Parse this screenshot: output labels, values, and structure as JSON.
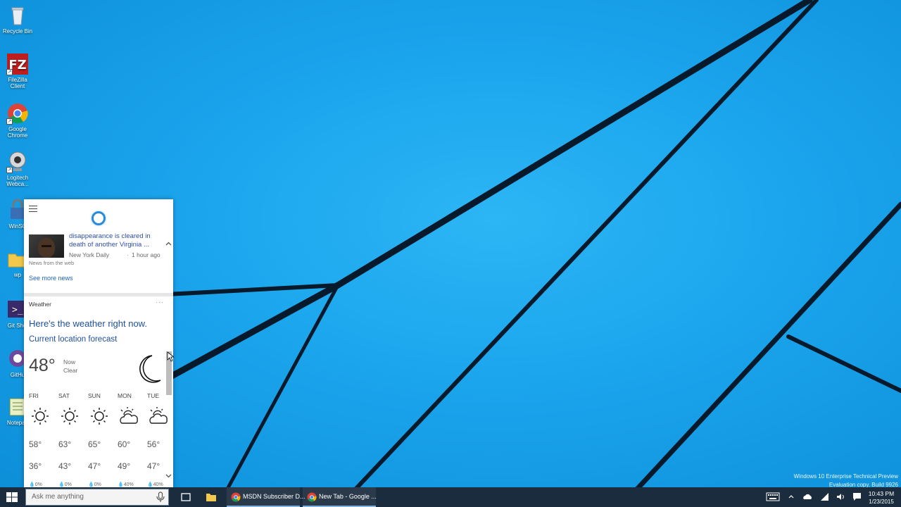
{
  "desktop": {
    "icons": [
      {
        "label": "Recycle Bin"
      },
      {
        "label": "FileZilla Client"
      },
      {
        "label": "Google Chrome"
      },
      {
        "label": "Logitech Webca..."
      },
      {
        "label": "WinSC"
      },
      {
        "label": "wp"
      },
      {
        "label": "Git Shel"
      },
      {
        "label": "GitHu"
      },
      {
        "label": "Notepad"
      }
    ],
    "watermark": {
      "line1": "Windows 10 Enterprise Technical Preview",
      "line2": "Evaluation copy. Build 9926"
    }
  },
  "cortana": {
    "news": {
      "headline": "disappearance is cleared in death of another Virginia ...",
      "source": "New York Daily",
      "separator": "·",
      "time": "1 hour ago",
      "from": "News from the web",
      "see_more": "See more news"
    },
    "weather": {
      "title": "Weather",
      "more": "···",
      "headline": "Here's the weather right now.",
      "subtitle": "Current location forecast",
      "temp": "48°",
      "now": "Now",
      "condition": "Clear",
      "icon": "moon-icon",
      "days": [
        {
          "name": "FRI",
          "icon": "sun-icon",
          "hi": "58°",
          "lo": "36°",
          "precip": "0%"
        },
        {
          "name": "SAT",
          "icon": "sun-icon",
          "hi": "63°",
          "lo": "43°",
          "precip": "0%"
        },
        {
          "name": "SUN",
          "icon": "sun-icon",
          "hi": "65°",
          "lo": "47°",
          "precip": "0%"
        },
        {
          "name": "MON",
          "icon": "partly-cloudy-icon",
          "hi": "60°",
          "lo": "49°",
          "precip": "40%"
        },
        {
          "name": "TUE",
          "icon": "partly-cloudy-icon",
          "hi": "56°",
          "lo": "47°",
          "precip": "40%"
        }
      ]
    }
  },
  "taskbar": {
    "search_placeholder": "Ask me anything",
    "apps": [
      {
        "label": "MSDN Subscriber D..."
      },
      {
        "label": "New Tab - Google ..."
      }
    ],
    "clock": {
      "time": "10:43 PM",
      "date": "1/23/2015"
    }
  },
  "colors": {
    "wallpaper": "#1aa4ec",
    "taskbar": "#1b2c3e",
    "cortana_accent": "#2a8ad8",
    "link": "#1e4f9c"
  }
}
